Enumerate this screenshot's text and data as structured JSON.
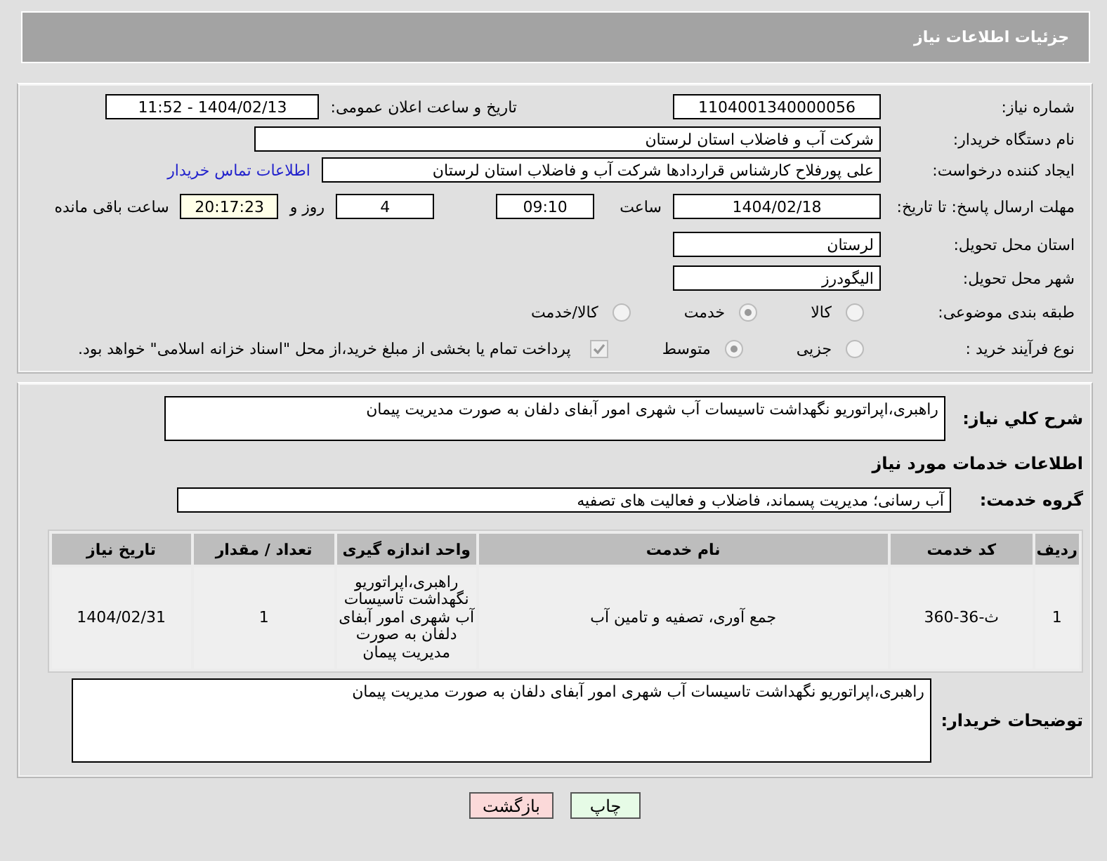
{
  "header": {
    "title": "جزئیات اطلاعات نیاز"
  },
  "need_number": {
    "label": "شماره نیاز:",
    "value": "1104001340000056"
  },
  "announce": {
    "label": "تاریخ و ساعت اعلان عمومی:",
    "value": "1404/02/13 - 11:52"
  },
  "buyer": {
    "label": "نام دستگاه خریدار:",
    "value": "شرکت آب و فاضلاب استان لرستان"
  },
  "creator": {
    "label": "ایجاد کننده درخواست:",
    "value": "علی پورفلاح کارشناس قراردادها شرکت آب و فاضلاب استان لرستان",
    "link": "اطلاعات تماس خریدار"
  },
  "deadline": {
    "label": "مهلت ارسال پاسخ: تا تاریخ:",
    "date": "1404/02/18",
    "time_label": "ساعت",
    "time": "09:10",
    "days": "4",
    "days_label": "روز و",
    "remaining": "20:17:23",
    "remaining_label": "ساعت باقی مانده"
  },
  "province": {
    "label": "استان محل تحویل:",
    "value": "لرستان"
  },
  "city": {
    "label": "شهر محل تحویل:",
    "value": "الیگودرز"
  },
  "category": {
    "label": "طبقه بندی موضوعی:",
    "options": [
      {
        "label": "کالا",
        "selected": false
      },
      {
        "label": "خدمت",
        "selected": true
      },
      {
        "label": "کالا/خدمت",
        "selected": false
      }
    ]
  },
  "purchase_type": {
    "label": "نوع فرآیند خرید :",
    "options": [
      {
        "label": "جزیی",
        "selected": false
      },
      {
        "label": "متوسط",
        "selected": true
      }
    ],
    "treasury": {
      "label": "پرداخت تمام یا بخشی از مبلغ خرید،از محل \"اسناد خزانه اسلامی\" خواهد بود.",
      "checked": true
    }
  },
  "summary": {
    "label": "شرح كلي نياز:",
    "value": "راهبری،اپراتوریو نگهداشت تاسیسات آب شهری امور آبفای دلفان به صورت مدیریت پیمان"
  },
  "services_heading": "اطلاعات خدمات مورد نیاز",
  "service_group": {
    "label": "گروه خدمت:",
    "value": "آب رسانی؛ مدیریت پسماند، فاضلاب و فعالیت های تصفیه"
  },
  "table": {
    "columns": [
      "ردیف",
      "کد خدمت",
      "نام خدمت",
      "واحد اندازه گیری",
      "تعداد / مقدار",
      "تاریخ نیاز"
    ],
    "rows": [
      [
        "1",
        "ث-36-360",
        "جمع آوری، تصفیه و تامین آب",
        "راهبری،اپراتوریو نگهداشت تاسیسات آب شهری امور آبفای دلفان به صورت مدیریت پیمان",
        "1",
        "1404/02/31"
      ]
    ]
  },
  "buyer_notes": {
    "label": "توضیحات خریدار:",
    "value": "راهبری،اپراتوریو نگهداشت تاسیسات آب شهری امور آبفای دلفان به صورت مدیریت پیمان"
  },
  "buttons": [
    {
      "label": "چاپ",
      "kind": "print"
    },
    {
      "label": "بازگشت",
      "kind": "back"
    }
  ]
}
